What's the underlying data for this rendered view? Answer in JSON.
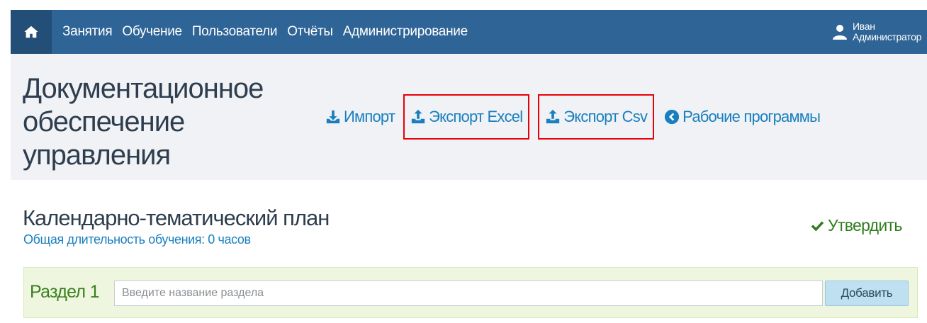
{
  "nav": {
    "home_icon": "home-icon",
    "items": [
      {
        "label": "Занятия"
      },
      {
        "label": "Обучение",
        "active": true
      },
      {
        "label": "Пользователи"
      },
      {
        "label": "Отчёты"
      },
      {
        "label": "Администрирование"
      }
    ],
    "user": {
      "icon": "user-icon",
      "first_name": "Иван",
      "role": "Администратор"
    }
  },
  "page": {
    "title": "Документационное обеспечение управления",
    "actions": {
      "import_label": "Импорт",
      "export_excel_label": "Экспорт Excel",
      "export_csv_label": "Экспорт Csv",
      "work_programs_label": "Рабочие программы"
    }
  },
  "plan": {
    "title": "Календарно-тематический план",
    "duration": "Общая длительность обучения: 0 часов",
    "approve_label": "Утвердить"
  },
  "section": {
    "label": "Раздел 1",
    "input_placeholder": "Введите название раздела",
    "input_value": "",
    "add_label": "Добавить"
  },
  "colors": {
    "navbar": "#2f6496",
    "link": "#1a7fbf",
    "highlight_border": "#e8000b",
    "approve": "#2f7d1e",
    "section_bg": "#eef6df"
  }
}
